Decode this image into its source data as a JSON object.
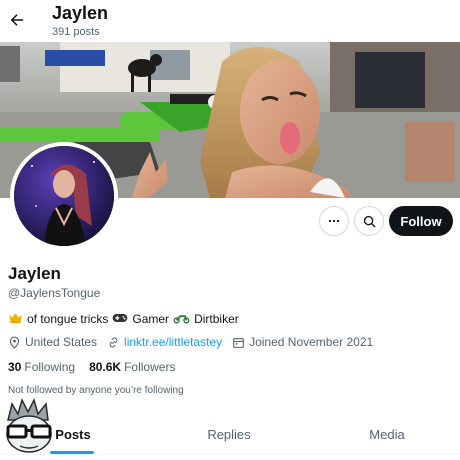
{
  "header": {
    "title": "Jaylen",
    "post_count": "391 posts"
  },
  "profile": {
    "name": "Jaylen",
    "handle": "@JaylensTongue",
    "bio": {
      "part1": "of tongue tricks",
      "part2": "Gamer",
      "part3": "Dirtbiker"
    },
    "location": "United States",
    "link": "linktr.ee/littletastey",
    "joined": "Joined November 2021",
    "following_count": "30",
    "following_label": "Following",
    "followers_count": "80.6K",
    "followers_label": "Followers",
    "followed_by_note": "Not followed by anyone you’re following"
  },
  "actions": {
    "follow_label": "Follow"
  },
  "tabs": [
    {
      "label": "Posts",
      "active": true
    },
    {
      "label": "Replies",
      "active": false
    },
    {
      "label": "Media",
      "active": false
    }
  ],
  "colors": {
    "accent": "#1d9bf0",
    "text_primary": "#0f1419",
    "text_secondary": "#536471",
    "follow_button_bg": "#0f1419"
  }
}
